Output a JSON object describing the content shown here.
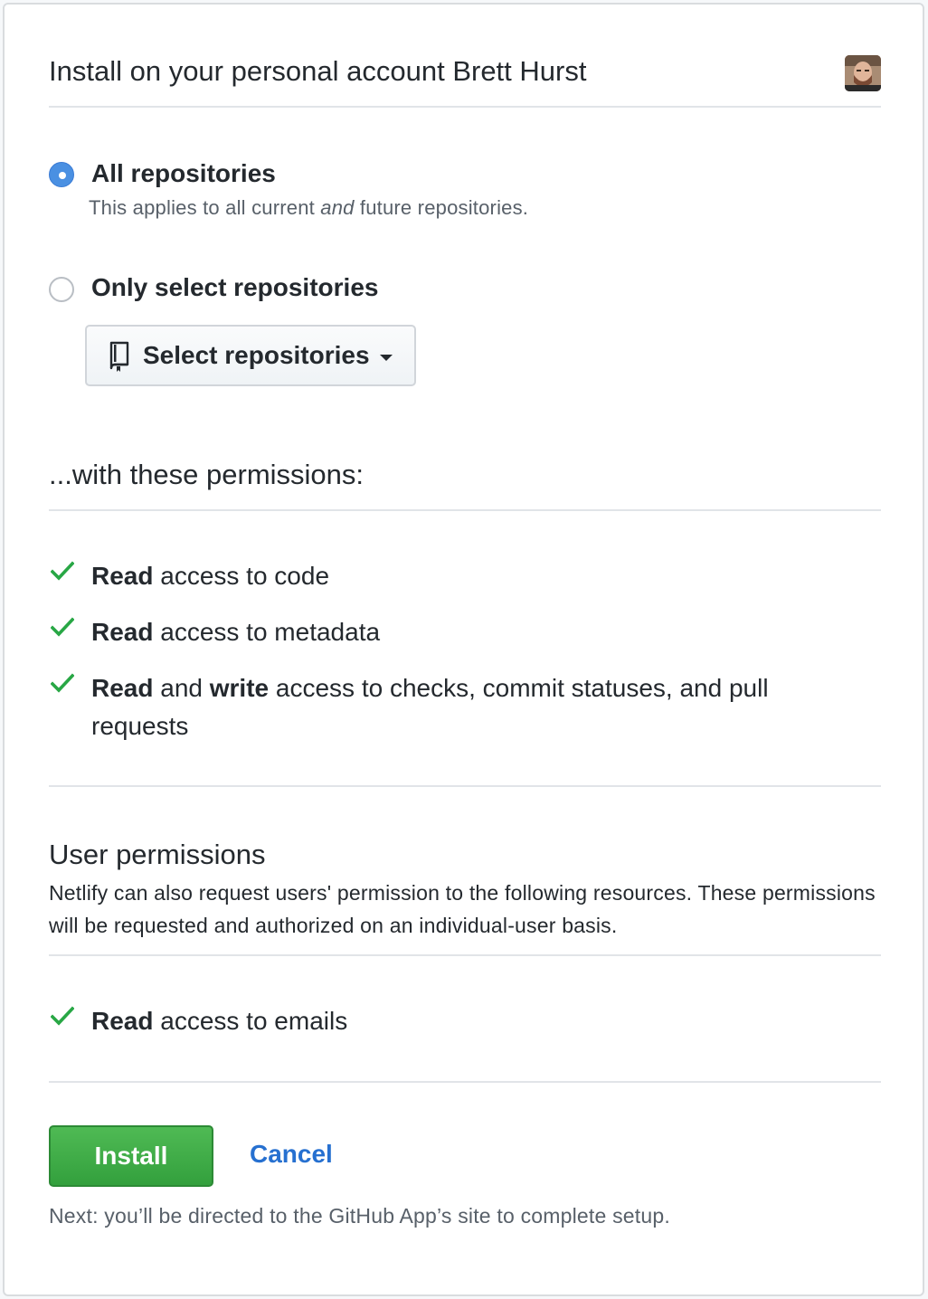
{
  "header": {
    "title": "Install on your personal account Brett Hurst"
  },
  "repository_access": {
    "options": [
      {
        "label": "All repositories",
        "checked": true,
        "description_before": "This applies to all current ",
        "description_emphasis": "and",
        "description_after": " future repositories."
      },
      {
        "label": "Only select repositories",
        "checked": false
      }
    ],
    "select_button_label": "Select repositories"
  },
  "permissions": {
    "title": "...with these permissions:",
    "items": [
      {
        "bold1": "Read",
        "mid": "",
        "bold2": "",
        "rest": " access to code"
      },
      {
        "bold1": "Read",
        "mid": "",
        "bold2": "",
        "rest": " access to metadata"
      },
      {
        "bold1": "Read",
        "mid": " and ",
        "bold2": "write",
        "rest": " access to checks, commit statuses, and pull requests"
      }
    ]
  },
  "user_permissions": {
    "title": "User permissions",
    "description": "Netlify can also request users' permission to the following resources. These permissions will be requested and authorized on an individual-user basis.",
    "items": [
      {
        "bold1": "Read",
        "mid": "",
        "bold2": "",
        "rest": " access to emails"
      }
    ]
  },
  "actions": {
    "install_label": "Install",
    "cancel_label": "Cancel",
    "next_note": "Next: you’ll be directed to the GitHub App’s site to complete setup."
  },
  "colors": {
    "accent_blue": "#4a90e2",
    "check_green": "#28a745",
    "install_green": "#3cab44",
    "link_blue": "#2670d0"
  },
  "icons": {
    "avatar": "user-avatar",
    "repo": "repo-book-icon",
    "check": "check-icon",
    "caret": "caret-down-icon"
  }
}
